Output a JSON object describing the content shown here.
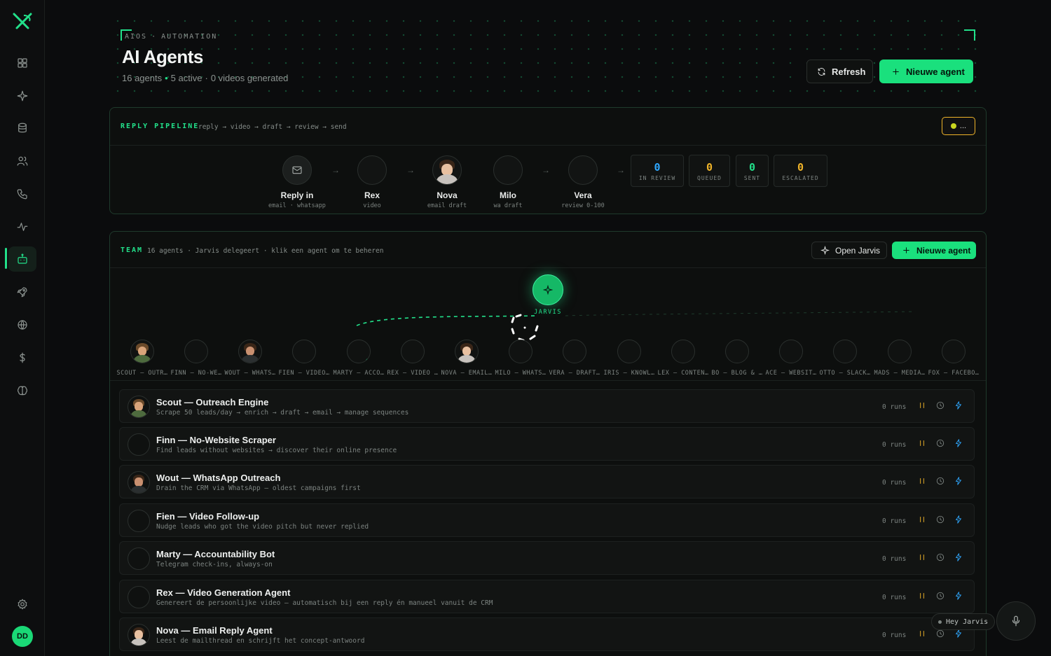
{
  "colors": {
    "accent": "#22e08a",
    "primary_button": "#1ae07d",
    "warning": "#f0b429",
    "info": "#2fa8ff"
  },
  "user": {
    "initials": "DD"
  },
  "sidebar": {
    "items": [
      {
        "icon": "grid-icon"
      },
      {
        "icon": "sparkle-icon"
      },
      {
        "icon": "database-icon"
      },
      {
        "icon": "users-icon"
      },
      {
        "icon": "phone-icon"
      },
      {
        "icon": "activity-icon"
      },
      {
        "icon": "bot-icon",
        "active": true
      },
      {
        "icon": "rocket-icon"
      },
      {
        "icon": "globe-icon"
      },
      {
        "icon": "dollar-icon"
      },
      {
        "icon": "brain-icon"
      }
    ],
    "settings_icon": "gear-icon"
  },
  "header": {
    "breadcrumb": [
      "AIOS",
      "AUTOMATION"
    ],
    "title": "AI Agents",
    "subtitle": {
      "agents": "16 agents",
      "active": "5 active",
      "videos": "0 videos generated"
    },
    "refresh_label": "Refresh",
    "new_agent_label": "Nieuwe agent"
  },
  "pipeline": {
    "title": "REPLY PIPELINE",
    "subtitle": "reply → video → draft → review → send",
    "status_label": "...",
    "nodes": [
      {
        "name": "Reply in",
        "role": "email · whatsapp"
      },
      {
        "name": "Rex",
        "role": "video"
      },
      {
        "name": "Nova",
        "role": "email draft"
      },
      {
        "name": "Milo",
        "role": "wa draft"
      },
      {
        "name": "Vera",
        "role": "review 0-100"
      }
    ],
    "stats": [
      {
        "value": "0",
        "label": "IN REVIEW",
        "color": "#2fa8ff"
      },
      {
        "value": "0",
        "label": "QUEUED",
        "color": "#f0b429"
      },
      {
        "value": "0",
        "label": "SENT",
        "color": "#22e08a"
      },
      {
        "value": "0",
        "label": "ESCALATED",
        "color": "#f0b429"
      }
    ]
  },
  "team": {
    "title": "TEAM",
    "subtitle": "16 agents · Jarvis delegeert · klik een agent om te beheren",
    "open_jarvis_label": "Open Jarvis",
    "new_agent_label": "Nieuwe agent",
    "hub_label": "JARVIS",
    "members": [
      {
        "label": "SCOUT — OUTR…"
      },
      {
        "label": "FINN — NO-WE…"
      },
      {
        "label": "WOUT — WHATS…"
      },
      {
        "label": "FIEN — VIDEO…"
      },
      {
        "label": "MARTY — ACCO…"
      },
      {
        "label": "REX — VIDEO …"
      },
      {
        "label": "NOVA — EMAIL…"
      },
      {
        "label": "MILO — WHATS…"
      },
      {
        "label": "VERA — DRAFT…"
      },
      {
        "label": "IRIS — KNOWL…"
      },
      {
        "label": "LEX — CONTEN…"
      },
      {
        "label": "BO — BLOG & …"
      },
      {
        "label": "ACE — WEBSIT…"
      },
      {
        "label": "OTTO — SLACK…"
      },
      {
        "label": "MADS — MEDIA…"
      },
      {
        "label": "FOX — FACEBO…"
      }
    ]
  },
  "agents": [
    {
      "title": "Scout — Outreach Engine",
      "desc": "Scrape 50 leads/day → enrich → draft → email → manage sequences",
      "runs": "0 runs"
    },
    {
      "title": "Finn — No-Website Scraper",
      "desc": "Find leads without websites → discover their online presence",
      "runs": "0 runs"
    },
    {
      "title": "Wout — WhatsApp Outreach",
      "desc": "Drain the CRM via WhatsApp — oldest campaigns first",
      "runs": "0 runs"
    },
    {
      "title": "Fien — Video Follow-up",
      "desc": "Nudge leads who got the video pitch but never replied",
      "runs": "0 runs"
    },
    {
      "title": "Marty — Accountability Bot",
      "desc": "Telegram check-ins, always-on",
      "runs": "0 runs"
    },
    {
      "title": "Rex — Video Generation Agent",
      "desc": "Genereert de persoonlijke video — automatisch bij een reply én manueel vanuit de CRM",
      "runs": "0 runs"
    },
    {
      "title": "Nova — Email Reply Agent",
      "desc": "Leest de mailthread en schrijft het concept-antwoord",
      "runs": "0 runs"
    }
  ],
  "voice": {
    "label": "Hey Jarvis"
  }
}
